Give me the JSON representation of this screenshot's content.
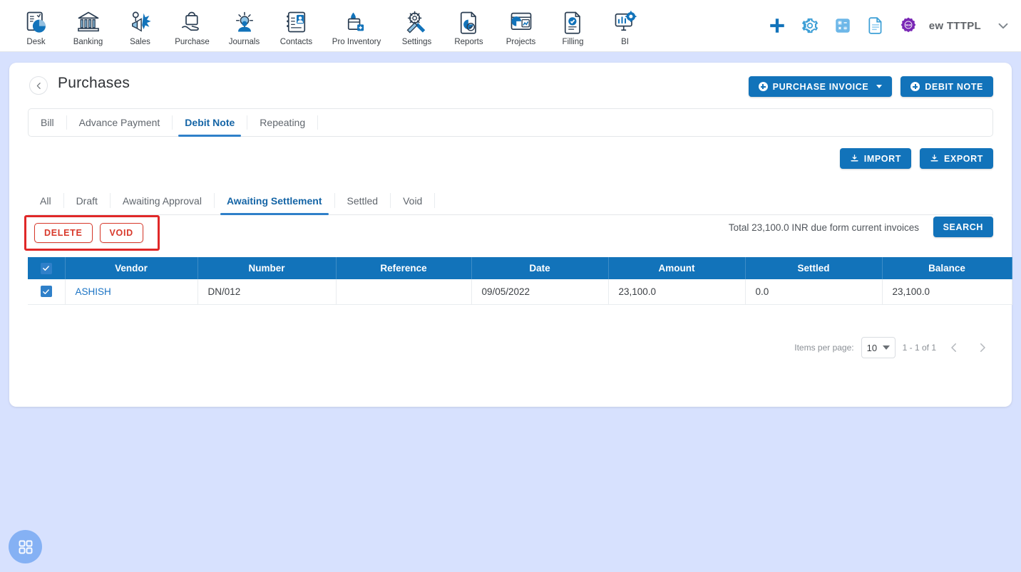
{
  "topnav": {
    "items": [
      {
        "label": "Desk",
        "icon": "dashboard-icon"
      },
      {
        "label": "Banking",
        "icon": "bank-icon"
      },
      {
        "label": "Sales",
        "icon": "sales-icon"
      },
      {
        "label": "Purchase",
        "icon": "purchase-icon"
      },
      {
        "label": "Journals",
        "icon": "journals-icon"
      },
      {
        "label": "Contacts",
        "icon": "contacts-icon"
      },
      {
        "label": "Pro Inventory",
        "icon": "inventory-icon"
      },
      {
        "label": "Settings",
        "icon": "settings-icon"
      },
      {
        "label": "Reports",
        "icon": "reports-icon"
      },
      {
        "label": "Projects",
        "icon": "projects-icon"
      },
      {
        "label": "Filling",
        "icon": "filling-icon"
      },
      {
        "label": "BI",
        "icon": "bi-icon"
      }
    ],
    "right": {
      "add_icon": "plus-icon",
      "settings_icon": "gear-icon",
      "calculator_icon": "calculator-icon",
      "notes_icon": "document-icon",
      "new_badge_icon": "new-badge-icon",
      "org_name": "ew TTTPL",
      "chevron_icon": "chevron-down-icon"
    }
  },
  "page": {
    "back_icon": "chevron-left-icon",
    "title": "Purchases",
    "actions": {
      "purchase_invoice": "PURCHASE INVOICE",
      "debit_note": "DEBIT NOTE"
    }
  },
  "tabs": [
    {
      "label": "Bill",
      "active": false
    },
    {
      "label": "Advance Payment",
      "active": false
    },
    {
      "label": "Debit Note",
      "active": true
    },
    {
      "label": "Repeating",
      "active": false
    }
  ],
  "toolbar": {
    "import": "IMPORT",
    "export": "EXPORT",
    "import_icon": "upload-icon",
    "export_icon": "download-icon"
  },
  "status_tabs": [
    {
      "label": "All",
      "active": false
    },
    {
      "label": "Draft",
      "active": false
    },
    {
      "label": "Awaiting Approval",
      "active": false
    },
    {
      "label": "Awaiting Settlement",
      "active": true
    },
    {
      "label": "Settled",
      "active": false
    },
    {
      "label": "Void",
      "active": false
    }
  ],
  "actions_bar": {
    "delete": "DELETE",
    "void": "VOID",
    "total_text": "Total 23,100.0 INR due form current invoices",
    "search": "SEARCH",
    "highlight_color": "#e02828"
  },
  "table": {
    "columns": [
      "Vendor",
      "Number",
      "Reference",
      "Date",
      "Amount",
      "Settled",
      "Balance"
    ],
    "header_checkbox_checked": true,
    "rows": [
      {
        "checked": true,
        "vendor": "ASHISH",
        "number": "DN/012",
        "reference": "",
        "date": "09/05/2022",
        "amount": "23,100.0",
        "settled": "0.0",
        "balance": "23,100.0"
      }
    ]
  },
  "pagination": {
    "items_per_page_label": "Items per page:",
    "items_per_page_value": "10",
    "range_text": "1 - 1 of 1",
    "prev_icon": "chevron-left-icon",
    "next_icon": "chevron-right-icon"
  },
  "fab": {
    "icon": "apps-grid-icon"
  },
  "colors": {
    "accent_blue": "#1273ba",
    "link_blue": "#1a73c4",
    "page_bg": "#d7e1fe",
    "danger_red": "#d8392b"
  }
}
